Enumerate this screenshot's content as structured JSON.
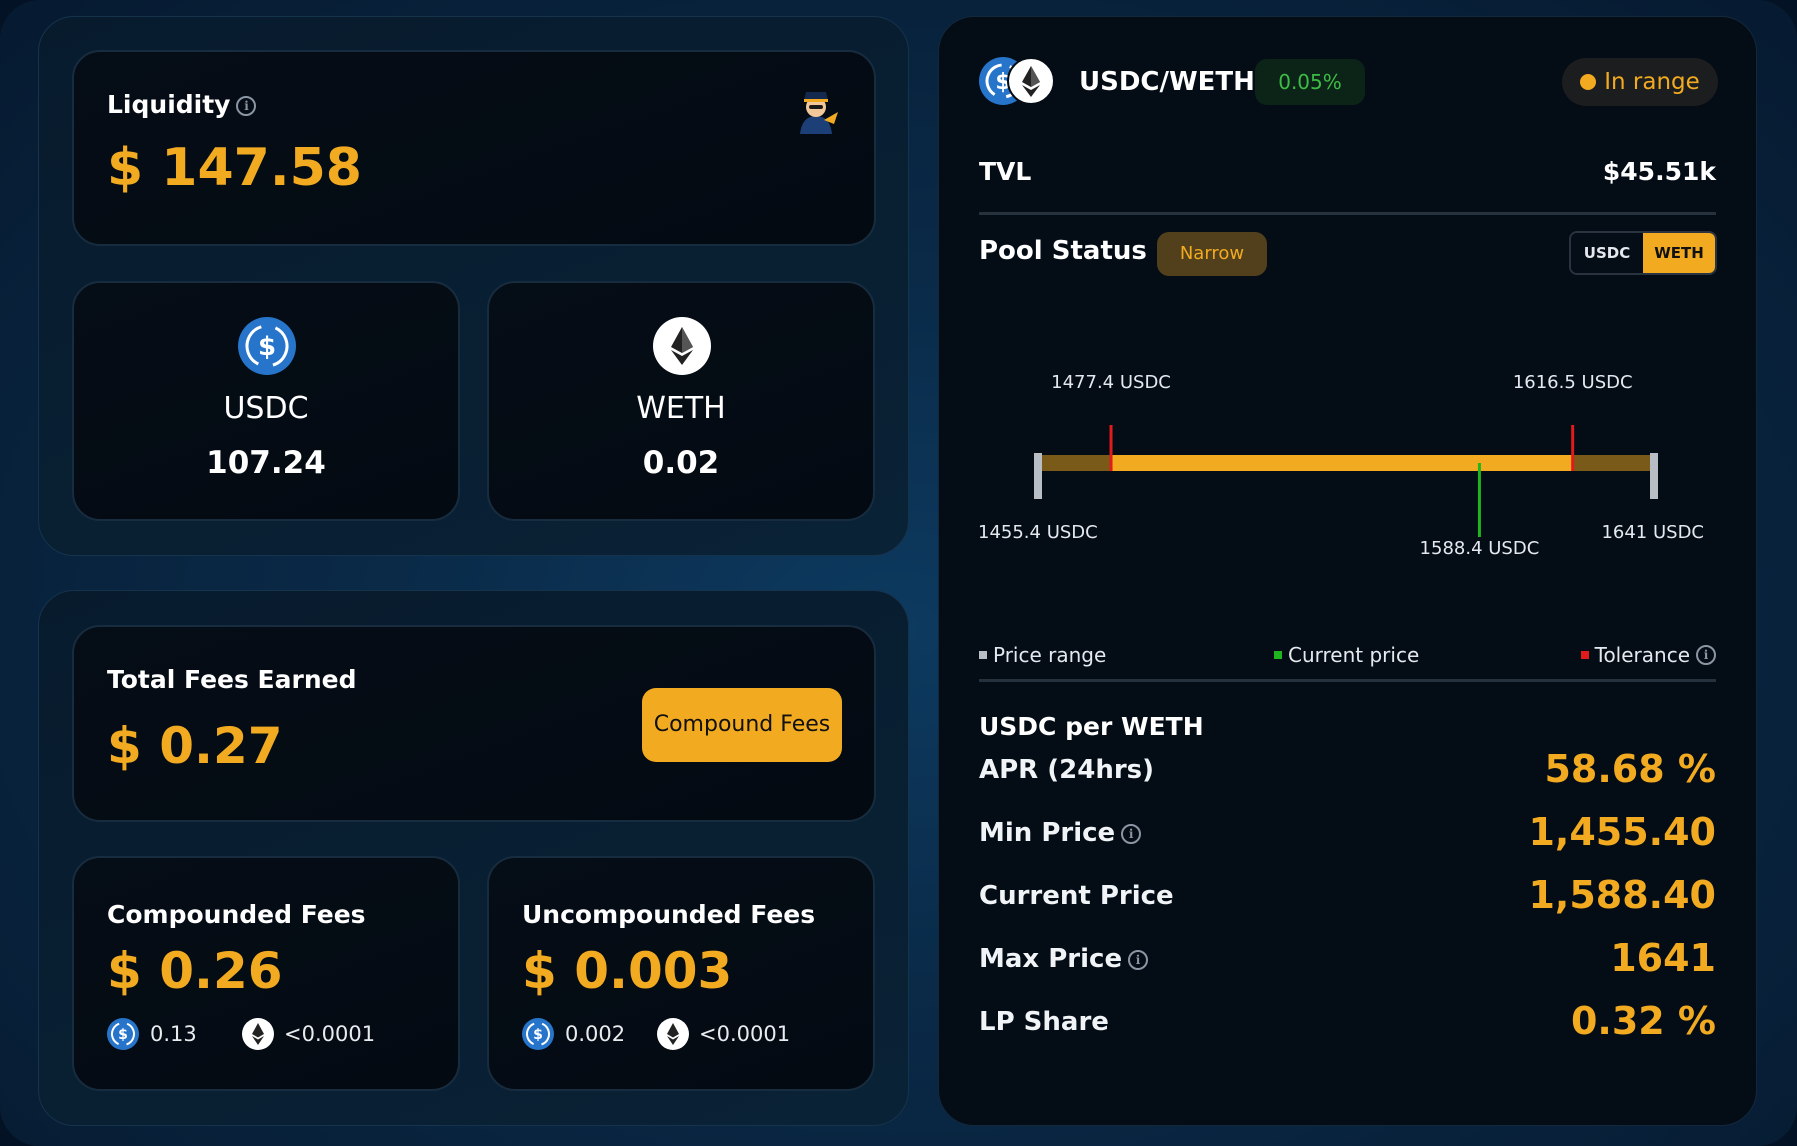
{
  "liquidity": {
    "label": "Liquidity",
    "value": "$ 147.58",
    "info_icon": "info-icon",
    "avatar_icon": "pilot-avatar-icon"
  },
  "tokens": [
    {
      "symbol": "USDC",
      "amount": "107.24",
      "icon": "usdc-icon"
    },
    {
      "symbol": "WETH",
      "amount": "0.02",
      "icon": "eth-icon"
    }
  ],
  "fees": {
    "total_label": "Total Fees Earned",
    "total_value": "$ 0.27",
    "compound_button": "Compound Fees",
    "compounded": {
      "label": "Compounded Fees",
      "value": "$ 0.26",
      "usdc": "0.13",
      "weth": "<0.0001"
    },
    "uncompounded": {
      "label": "Uncompounded Fees",
      "value": "$ 0.003",
      "usdc": "0.002",
      "weth": "<0.0001"
    }
  },
  "pool": {
    "pair": "USDC/WETH",
    "fee_tier": "0.05%",
    "range_status": "In range",
    "tvl_label": "TVL",
    "tvl_value": "$45.51k",
    "status_label": "Pool Status",
    "status_badge": "Narrow",
    "toggle": [
      "USDC",
      "WETH"
    ],
    "toggle_selected": "WETH"
  },
  "range_chart": {
    "min": 1455.4,
    "max": 1641,
    "tolerance_low": 1477.4,
    "tolerance_high": 1616.5,
    "current": 1588.4,
    "labels": {
      "tolerance_low": "1477.4 USDC",
      "tolerance_high": "1616.5 USDC",
      "min": "1455.4 USDC",
      "current": "1588.4 USDC",
      "max": "1641 USDC"
    },
    "colors": {
      "range": "#f2ab21",
      "range_dim": "#7a5a18",
      "current": "#1eb51e",
      "tolerance": "#e01b1b",
      "bound": "#b9bec4"
    }
  },
  "legend": {
    "price_range": "Price range",
    "current_price": "Current price",
    "tolerance": "Tolerance"
  },
  "metrics": {
    "title": "USDC per WETH",
    "rows": [
      {
        "label": "APR (24hrs)",
        "value": "58.68 %",
        "info": false
      },
      {
        "label": "Min Price",
        "value": "1,455.40",
        "info": true
      },
      {
        "label": "Current Price",
        "value": "1,588.40",
        "info": false
      },
      {
        "label": "Max Price",
        "value": "1641",
        "info": true
      },
      {
        "label": "LP Share",
        "value": "0.32 %",
        "info": false
      }
    ]
  }
}
